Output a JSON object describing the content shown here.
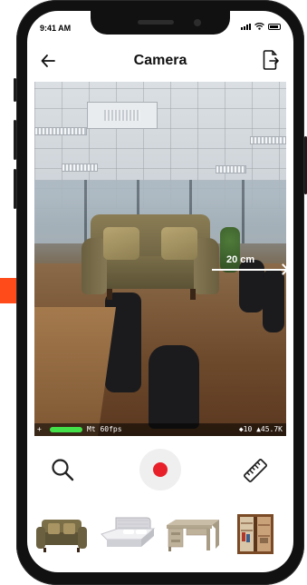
{
  "status_bar": {
    "time": "9:41 AM"
  },
  "header": {
    "title": "Camera",
    "back_icon": "arrow-left-icon",
    "export_icon": "file-export-icon"
  },
  "ar_view": {
    "placed_object": "sofa",
    "measurement": {
      "label": "20 cm"
    },
    "hud": {
      "plus": "+",
      "fps": "Mt 60fps",
      "stats": "◆10 ▲45.7K"
    }
  },
  "toolbar": {
    "search_icon": "search-icon",
    "record_icon": "record-icon",
    "ruler_icon": "ruler-icon"
  },
  "catalog": {
    "items": [
      "sofa",
      "bed",
      "desk",
      "wardrobe"
    ]
  },
  "colors": {
    "record": "#e8202a",
    "pointer_arrow": "#ff4a1a",
    "hud_bar": "#44e04a"
  }
}
